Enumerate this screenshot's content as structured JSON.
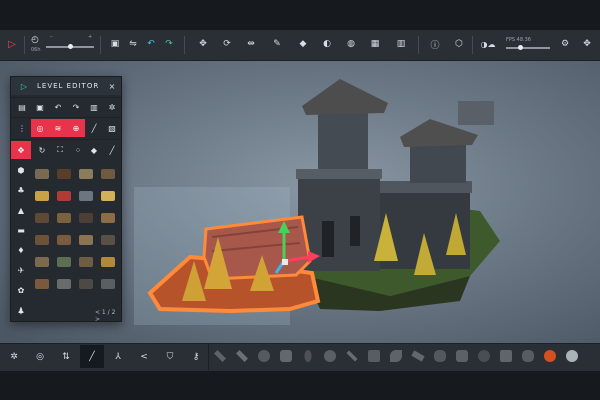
{
  "app": {
    "accent_color": "#e8334b",
    "background_color": "#161a1f"
  },
  "toolbar": {
    "play_icon": "play-icon",
    "time_label": "06h",
    "fps_label": "FPS 48.36",
    "items": [
      "timer-icon",
      "slider",
      "camera-icon",
      "flip-icon",
      "undo-icon",
      "redo-icon",
      "move-icon",
      "rotate-icon",
      "scale-icon",
      "brush-icon",
      "fill-icon",
      "brightness-icon",
      "globe-icon",
      "grid-icon",
      "trash-icon",
      "info-icon",
      "cube-icon",
      "weather-icon",
      "gear-icon",
      "expand-icon"
    ]
  },
  "level_editor": {
    "title": "LEVEL EDITOR",
    "close_label": "×",
    "pager_label": "< 1 / 2 >",
    "categories": [
      "transform-icon",
      "stone-icon",
      "tree-icon",
      "mountain-icon",
      "fence-icon",
      "torch-icon",
      "bird-icon",
      "flower-icon",
      "person-icon",
      "star-icon"
    ]
  },
  "bottombar": {
    "tools": [
      "settings-icon",
      "target-icon",
      "route-icon",
      "wand-icon",
      "tripod-icon",
      "share-icon",
      "shield-icon",
      "key-icon"
    ],
    "materials": [
      "wood-icon",
      "pipe-icon",
      "plate-icon",
      "brick-icon",
      "chain-icon",
      "gear-icon",
      "pole-icon",
      "stamp-icon",
      "leaf-icon",
      "blade-icon",
      "rock-icon",
      "scroll-icon",
      "coal-icon",
      "bark-icon",
      "ore-icon",
      "lava-icon",
      "moon-icon"
    ]
  }
}
